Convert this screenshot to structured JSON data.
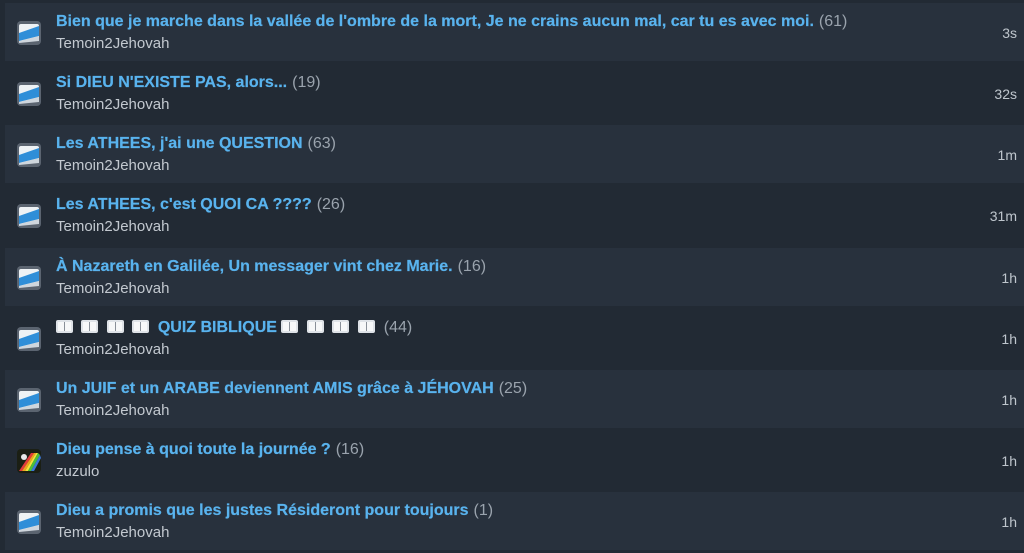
{
  "topics": [
    {
      "title": "Bien que je marche dans la vallée de l'ombre de la mort, Je ne crains aucun mal, car tu es avec moi.",
      "count": "(61)",
      "author": "Temoin2Jehovah",
      "time": "3s",
      "avatar": "topic-icon"
    },
    {
      "title": "Si DIEU N'EXISTE PAS, alors...",
      "count": "(19)",
      "author": "Temoin2Jehovah",
      "time": "32s",
      "avatar": "topic-icon"
    },
    {
      "title": "Les ATHEES, j'ai une QUESTION",
      "count": "(63)",
      "author": "Temoin2Jehovah",
      "time": "1m",
      "avatar": "topic-icon"
    },
    {
      "title": "Les ATHEES, c'est QUOI CA ????",
      "count": "(26)",
      "author": "Temoin2Jehovah",
      "time": "31m",
      "avatar": "topic-icon"
    },
    {
      "title": "À Nazareth en Galilée, Un messager vint chez Marie.",
      "count": "(16)",
      "author": "Temoin2Jehovah",
      "time": "1h",
      "avatar": "topic-icon"
    },
    {
      "title": "QUIZ BIBLIQUE",
      "count": "(44)",
      "author": "Temoin2Jehovah",
      "time": "1h",
      "avatar": "topic-icon",
      "book_icons_before": 4,
      "book_icons_after": 4
    },
    {
      "title": "Un JUIF et un ARABE deviennent AMIS grâce à JÉHOVAH",
      "count": "(25)",
      "author": "Temoin2Jehovah",
      "time": "1h",
      "avatar": "topic-icon"
    },
    {
      "title": "Dieu pense à quoi toute la journée ?",
      "count": "(16)",
      "author": "zuzulo",
      "time": "1h",
      "avatar": "rainbow-avatar"
    },
    {
      "title": "Dieu a promis que les justes Résideront pour toujours",
      "count": "(1)",
      "author": "Temoin2Jehovah",
      "time": "1h",
      "avatar": "topic-icon"
    }
  ],
  "colors": {
    "title": "#59b3ee",
    "count": "#9aa3ad",
    "author": "#c3c9d0",
    "row": "#28313d",
    "row_alt": "#222a34"
  }
}
